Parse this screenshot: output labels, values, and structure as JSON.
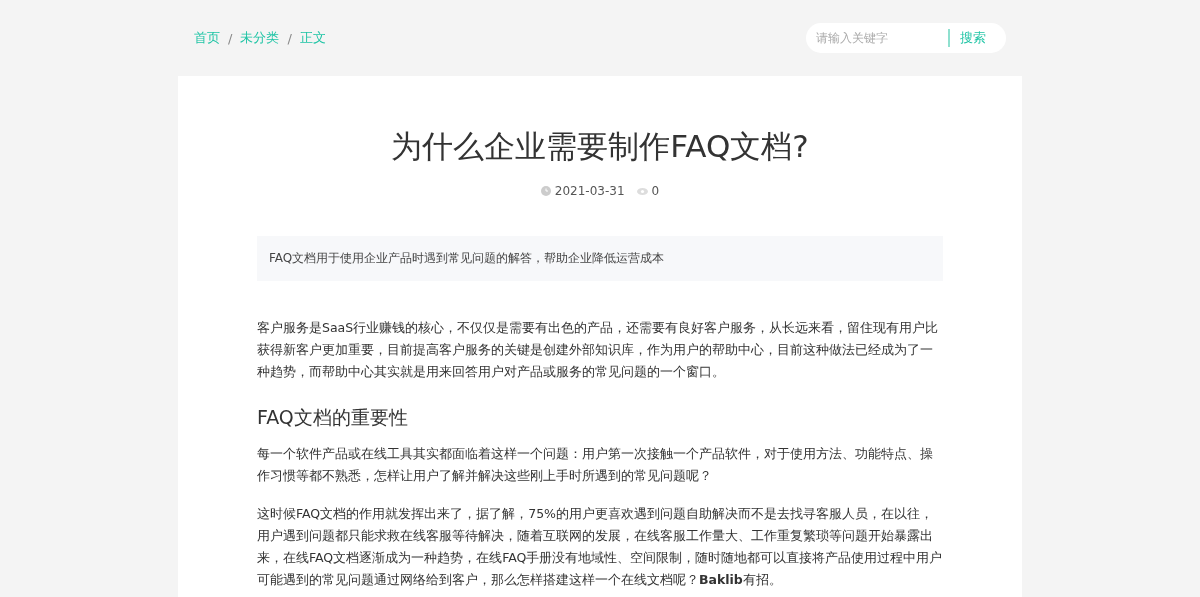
{
  "breadcrumb": [
    {
      "label": "首页"
    },
    {
      "label": "未分类"
    },
    {
      "label": "正文"
    }
  ],
  "breadcrumb_separator": "/",
  "search": {
    "placeholder": "请输入关键字",
    "button": "搜索"
  },
  "article": {
    "title": "为什么企业需要制作FAQ文档?",
    "date": "2021-03-31",
    "views": "0",
    "summary": "FAQ文档用于使用企业产品时遇到常见问题的解答，帮助企业降低运营成本",
    "blocks": [
      {
        "kind": "paragraph",
        "text": "客户服务是SaaS行业赚钱的核心，不仅仅是需要有出色的产品，还需要有良好客户服务，从长远来看，留住现有用户比获得新客户更加重要，目前提高客户服务的关键是创建外部知识库，作为用户的帮助中心，目前这种做法已经成为了一种趋势，而帮助中心其实就是用来回答用户对产品或服务的常见问题的一个窗口。"
      },
      {
        "kind": "heading",
        "text": "FAQ文档的重要性"
      },
      {
        "kind": "paragraph",
        "text": "每一个软件产品或在线工具其实都面临着这样一个问题：用户第一次接触一个产品软件，对于使用方法、功能特点、操作习惯等都不熟悉，怎样让用户了解并解决这些刚上手时所遇到的常见问题呢？"
      },
      {
        "kind": "paragraph",
        "text": "这时候FAQ文档的作用就发挥出来了，据了解，75%的用户更喜欢遇到问题自助解决而不是去找寻客服人员，在以往，用户遇到问题都只能求救在线客服等待解决，随着互联网的发展，在线客服工作量大、工作重复繁琐等问题开始暴露出来，在线FAQ文档逐渐成为一种趋势，在线FAQ手册没有地域性、空间限制，随时随地都可以直接将产品使用过程中用户可能遇到的常见问题通过网络给到客户，那么怎样搭建这样一个在线文档呢？**Baklib**有招。"
      }
    ]
  }
}
